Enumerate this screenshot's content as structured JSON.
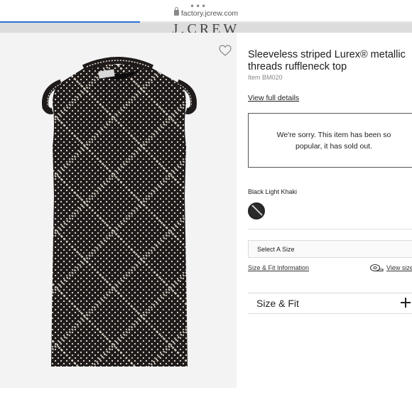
{
  "browser": {
    "url": "factory.jcrew.com",
    "more_glyph": "•••",
    "load_progress": 0.34
  },
  "site": {
    "logo_text": "J.CREW"
  },
  "product": {
    "title": "Sleeveless striped Lurex® metallic threads ruffleneck top",
    "item_number": "Item BM020",
    "view_full_details": "View full details",
    "sold_out_message": "We're sorry. This item has been so popular, it has sold out.",
    "color_name": "Black Light Khaki",
    "size_placeholder": "Select A Size",
    "size_fit_info_link": "Size & Fit Information",
    "view_size_link": "View size",
    "size_fit_section": "Size & Fit"
  },
  "icons": {
    "favorite": "heart-icon",
    "lock": "lock-icon",
    "tape": "measuring-tape-icon",
    "expand": "plus-icon"
  },
  "colors": {
    "garment": "#1f1b1b",
    "dot": "#e8e2d4",
    "progress": "#2a6fd6"
  }
}
